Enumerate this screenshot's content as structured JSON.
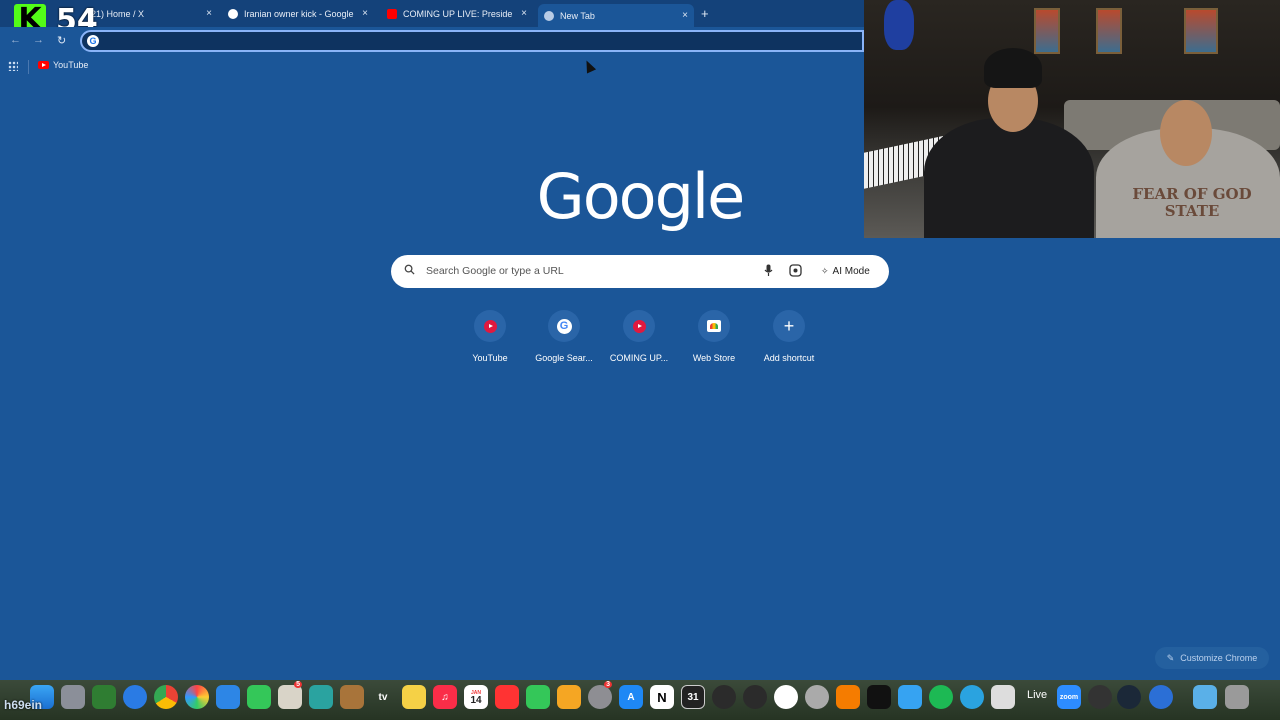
{
  "overlay": {
    "kick_logo": "K",
    "viewer_count": "54",
    "streamer_name": "h69ein"
  },
  "tabs": [
    {
      "title": "(21) Home / X",
      "favicon": "x-icon",
      "active": false
    },
    {
      "title": "Iranian owner kick - Google S",
      "favicon": "google-icon",
      "active": false
    },
    {
      "title": "COMING UP LIVE: President T",
      "favicon": "youtube-icon",
      "active": false
    },
    {
      "title": "New Tab",
      "favicon": "chrome-icon",
      "active": true
    }
  ],
  "tab_close_glyph": "×",
  "new_tab_glyph": "+",
  "toolbar": {
    "back": "←",
    "forward": "→",
    "reload": "↻",
    "omnibox_badge": "G",
    "omnibox_value": ""
  },
  "bookmarks": [
    {
      "label": "YouTube",
      "icon": "youtube-icon"
    }
  ],
  "google_logo": "Google",
  "search": {
    "placeholder": "Search Google or type a URL",
    "ai_mode_label": "AI Mode"
  },
  "shortcuts": [
    {
      "label": "YouTube",
      "icon": "youtube-icon"
    },
    {
      "label": "Google Sear...",
      "icon": "google-icon"
    },
    {
      "label": "COMING UP...",
      "icon": "youtube-icon"
    },
    {
      "label": "Web Store",
      "icon": "web-store-icon"
    },
    {
      "label": "Add shortcut",
      "icon": "plus-icon"
    }
  ],
  "webcam": {
    "hoodie_text": "FEAR OF GOD STATE"
  },
  "customize_label": "Customize Chrome",
  "dock": {
    "calendar_month": "JAN",
    "calendar_day": "14",
    "notion_glyph": "N",
    "calendar2_day": "31",
    "live_label": "Live",
    "zoom_label": "zoom",
    "tv_label": "tv",
    "badges": {
      "contacts": "5",
      "settings": "3"
    }
  },
  "colors": {
    "background": "#1b5698",
    "tabstrip": "#14427a",
    "kick_green": "#53fc18",
    "youtube_red": "#ff0000"
  }
}
